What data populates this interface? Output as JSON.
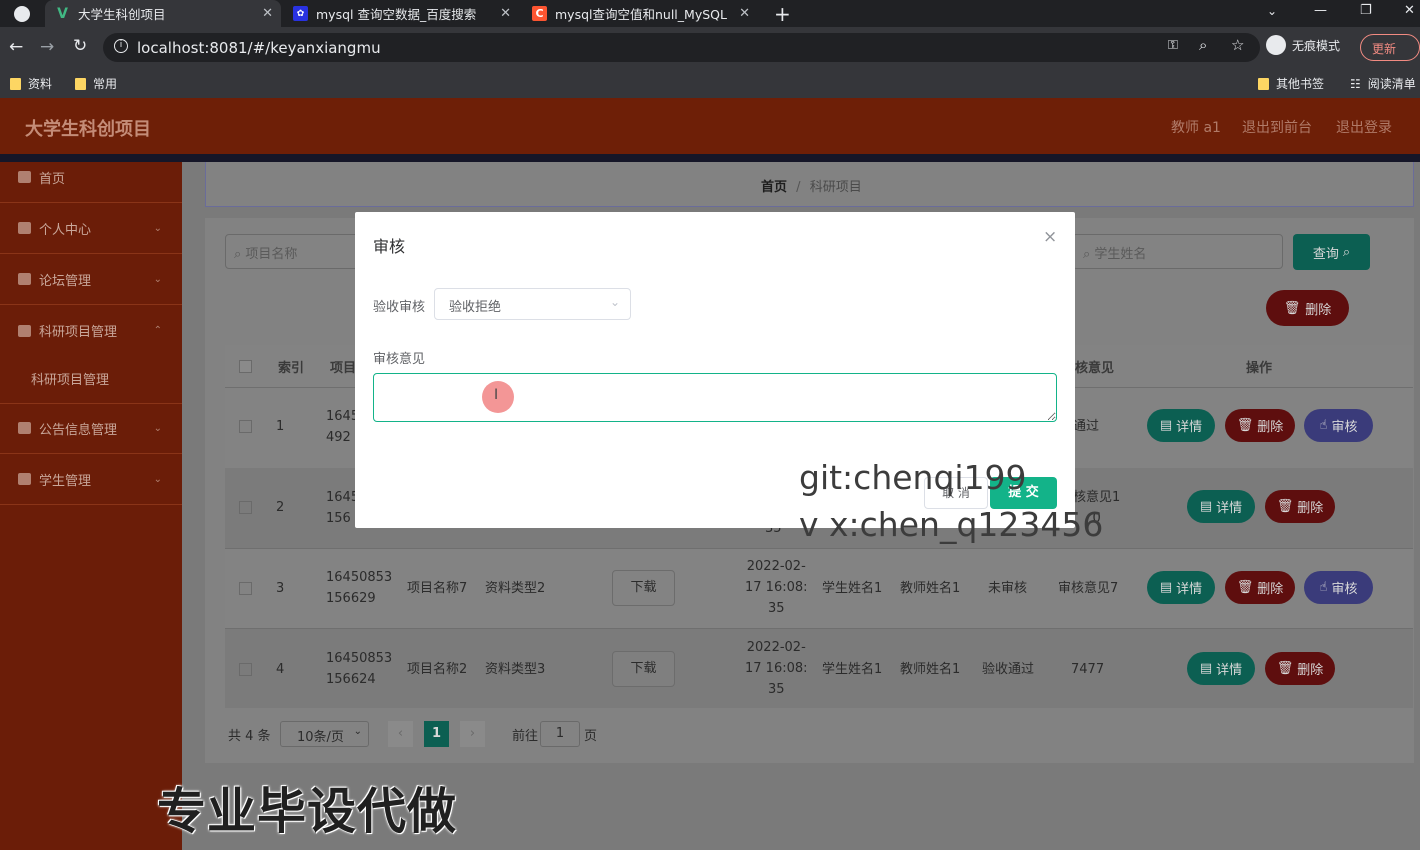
{
  "browser": {
    "tabs": [
      {
        "title": "大学生科创项目",
        "active": true
      },
      {
        "title": "mysql 查询空数据_百度搜索",
        "active": false
      },
      {
        "title": "mysql查询空值和null_MySQL数",
        "active": false
      }
    ],
    "new_tab": "+",
    "url": "localhost:8081/#/keyanxiangmu",
    "incognito_label": "无痕模式",
    "update_label": "更新",
    "bookmarks": [
      "资料",
      "常用"
    ],
    "other_bookmarks": "其他书签",
    "reading_list": "阅读清单"
  },
  "header": {
    "title": "大学生科创项目",
    "user": "教师 a1",
    "links": [
      "退出到前台",
      "退出登录"
    ]
  },
  "sidebar": {
    "items": [
      {
        "label": "首页"
      },
      {
        "label": "个人中心"
      },
      {
        "label": "论坛管理"
      },
      {
        "label": "科研项目管理"
      },
      {
        "label": "科研项目管理"
      },
      {
        "label": "公告信息管理"
      },
      {
        "label": "学生管理"
      }
    ]
  },
  "breadcrumb": {
    "home": "首页",
    "sep": "/",
    "current": "科研项目"
  },
  "search": {
    "project_placeholder": "项目名称",
    "student_placeholder": "学生姓名",
    "query_label": "查询",
    "delete_label": "删除"
  },
  "table": {
    "headers": [
      "索引",
      "项目",
      "核意见",
      "操作"
    ],
    "rows": [
      {
        "index": "1",
        "id_a": "1645",
        "id_b": "492",
        "name": "",
        "type": "",
        "date": [
          "",
          "",
          ""
        ],
        "student": "",
        "teacher": "",
        "status": "",
        "opinion": "通过",
        "has_audit": true
      },
      {
        "index": "2",
        "id_a": "1645",
        "id_b": "156",
        "name": "",
        "type": "",
        "date": [
          "",
          "",
          "35"
        ],
        "student": "",
        "teacher": "",
        "status": "",
        "opinion": "核意见1\n0",
        "has_audit": false
      },
      {
        "index": "3",
        "id_a": "16450853",
        "id_b": "156629",
        "name": "项目名称7",
        "type": "资料类型2",
        "date": [
          "2022-02-",
          "17 16:08:",
          "35"
        ],
        "student": "学生姓名1",
        "teacher": "教师姓名1",
        "status": "未审核",
        "opinion": "审核意见7",
        "has_audit": true
      },
      {
        "index": "4",
        "id_a": "16450853",
        "id_b": "156624",
        "name": "项目名称2",
        "type": "资料类型3",
        "date": [
          "2022-02-",
          "17 16:08:",
          "35"
        ],
        "student": "学生姓名1",
        "teacher": "教师姓名1",
        "status": "验收通过",
        "opinion": "7477",
        "has_audit": false
      }
    ],
    "download_label": "下载",
    "detail_label": "详情",
    "delete_label": "删除",
    "audit_label": "审核"
  },
  "pagination": {
    "total": "共 4 条",
    "page_size": "10条/页",
    "current_page": "1",
    "goto_prefix": "前往",
    "goto_value": "1",
    "goto_suffix": "页"
  },
  "modal": {
    "title": "审核",
    "close": "×",
    "field_label": "验收审核",
    "field_value": "验收拒绝",
    "opinion_label": "审核意见",
    "opinion_value": "",
    "cancel_label": "取 消",
    "submit_label": "提 交"
  },
  "watermarks": [
    "git:chenqi199",
    "v x:chen_q123456",
    "专业毕设代做"
  ],
  "colors": {
    "accent": "#13b389",
    "header": "#6e1f07",
    "danger": "#c0302d"
  }
}
